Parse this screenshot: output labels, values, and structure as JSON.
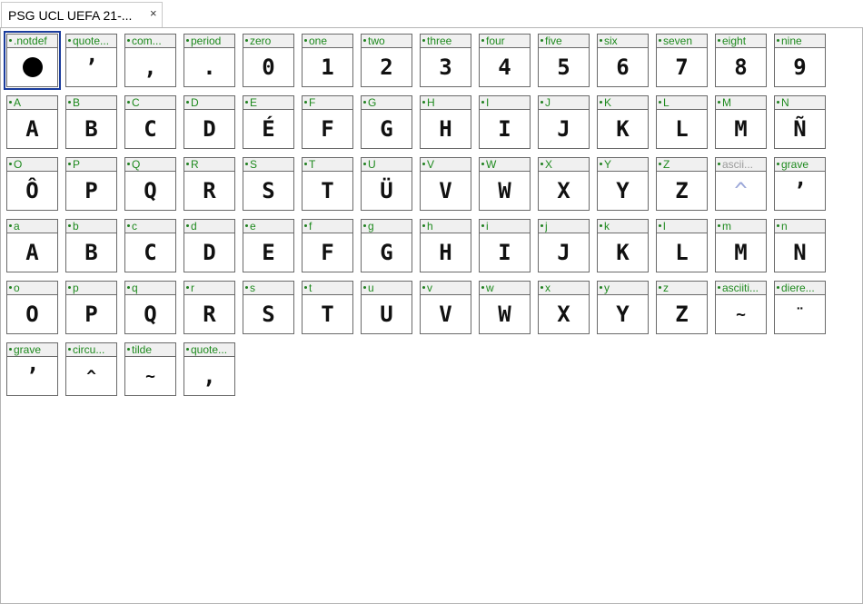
{
  "tab": {
    "title": "PSG UCL UEFA 21-...",
    "close": "×"
  },
  "glyphs": [
    {
      "name": ".notdef",
      "char": "",
      "notdef": true,
      "selected": true
    },
    {
      "name": "quote...",
      "char": "ʼ"
    },
    {
      "name": "com...",
      "char": ","
    },
    {
      "name": "period",
      "char": "."
    },
    {
      "name": "zero",
      "char": "0"
    },
    {
      "name": "one",
      "char": "1"
    },
    {
      "name": "two",
      "char": "2"
    },
    {
      "name": "three",
      "char": "3"
    },
    {
      "name": "four",
      "char": "4"
    },
    {
      "name": "five",
      "char": "5"
    },
    {
      "name": "six",
      "char": "6"
    },
    {
      "name": "seven",
      "char": "7"
    },
    {
      "name": "eight",
      "char": "8"
    },
    {
      "name": "nine",
      "char": "9"
    },
    {
      "name": "A",
      "char": "A"
    },
    {
      "name": "B",
      "char": "B"
    },
    {
      "name": "C",
      "char": "C"
    },
    {
      "name": "D",
      "char": "D"
    },
    {
      "name": "E",
      "char": "É"
    },
    {
      "name": "F",
      "char": "F"
    },
    {
      "name": "G",
      "char": "G"
    },
    {
      "name": "H",
      "char": "H"
    },
    {
      "name": "I",
      "char": "I"
    },
    {
      "name": "J",
      "char": "J"
    },
    {
      "name": "K",
      "char": "K"
    },
    {
      "name": "L",
      "char": "L"
    },
    {
      "name": "M",
      "char": "M"
    },
    {
      "name": "N",
      "char": "Ñ"
    },
    {
      "name": "O",
      "char": "Ô"
    },
    {
      "name": "P",
      "char": "P"
    },
    {
      "name": "Q",
      "char": "Q"
    },
    {
      "name": "R",
      "char": "R"
    },
    {
      "name": "S",
      "char": "S"
    },
    {
      "name": "T",
      "char": "T"
    },
    {
      "name": "U",
      "char": "Ü"
    },
    {
      "name": "V",
      "char": "V"
    },
    {
      "name": "W",
      "char": "W"
    },
    {
      "name": "X",
      "char": "X"
    },
    {
      "name": "Y",
      "char": "Y"
    },
    {
      "name": "Z",
      "char": "Z"
    },
    {
      "name": "ascii...",
      "char": "^",
      "missing": true
    },
    {
      "name": "grave",
      "char": "ʼ"
    },
    {
      "name": "a",
      "char": "A"
    },
    {
      "name": "b",
      "char": "B"
    },
    {
      "name": "c",
      "char": "C"
    },
    {
      "name": "d",
      "char": "D"
    },
    {
      "name": "e",
      "char": "E"
    },
    {
      "name": "f",
      "char": "F"
    },
    {
      "name": "g",
      "char": "G"
    },
    {
      "name": "h",
      "char": "H"
    },
    {
      "name": "i",
      "char": "I"
    },
    {
      "name": "j",
      "char": "J"
    },
    {
      "name": "k",
      "char": "K"
    },
    {
      "name": "l",
      "char": "L"
    },
    {
      "name": "m",
      "char": "M"
    },
    {
      "name": "n",
      "char": "N"
    },
    {
      "name": "o",
      "char": "O"
    },
    {
      "name": "p",
      "char": "P"
    },
    {
      "name": "q",
      "char": "Q"
    },
    {
      "name": "r",
      "char": "R"
    },
    {
      "name": "s",
      "char": "S"
    },
    {
      "name": "t",
      "char": "T"
    },
    {
      "name": "u",
      "char": "U"
    },
    {
      "name": "v",
      "char": "V"
    },
    {
      "name": "w",
      "char": "W"
    },
    {
      "name": "x",
      "char": "X"
    },
    {
      "name": "y",
      "char": "Y"
    },
    {
      "name": "z",
      "char": "Z"
    },
    {
      "name": "asciiti...",
      "char": "~",
      "small": true
    },
    {
      "name": "diere...",
      "char": "¨",
      "small": true
    },
    {
      "name": "grave",
      "char": "ʼ"
    },
    {
      "name": "circu...",
      "char": "^",
      "small": true
    },
    {
      "name": "tilde",
      "char": "~",
      "small": true
    },
    {
      "name": "quote...",
      "char": ","
    }
  ]
}
